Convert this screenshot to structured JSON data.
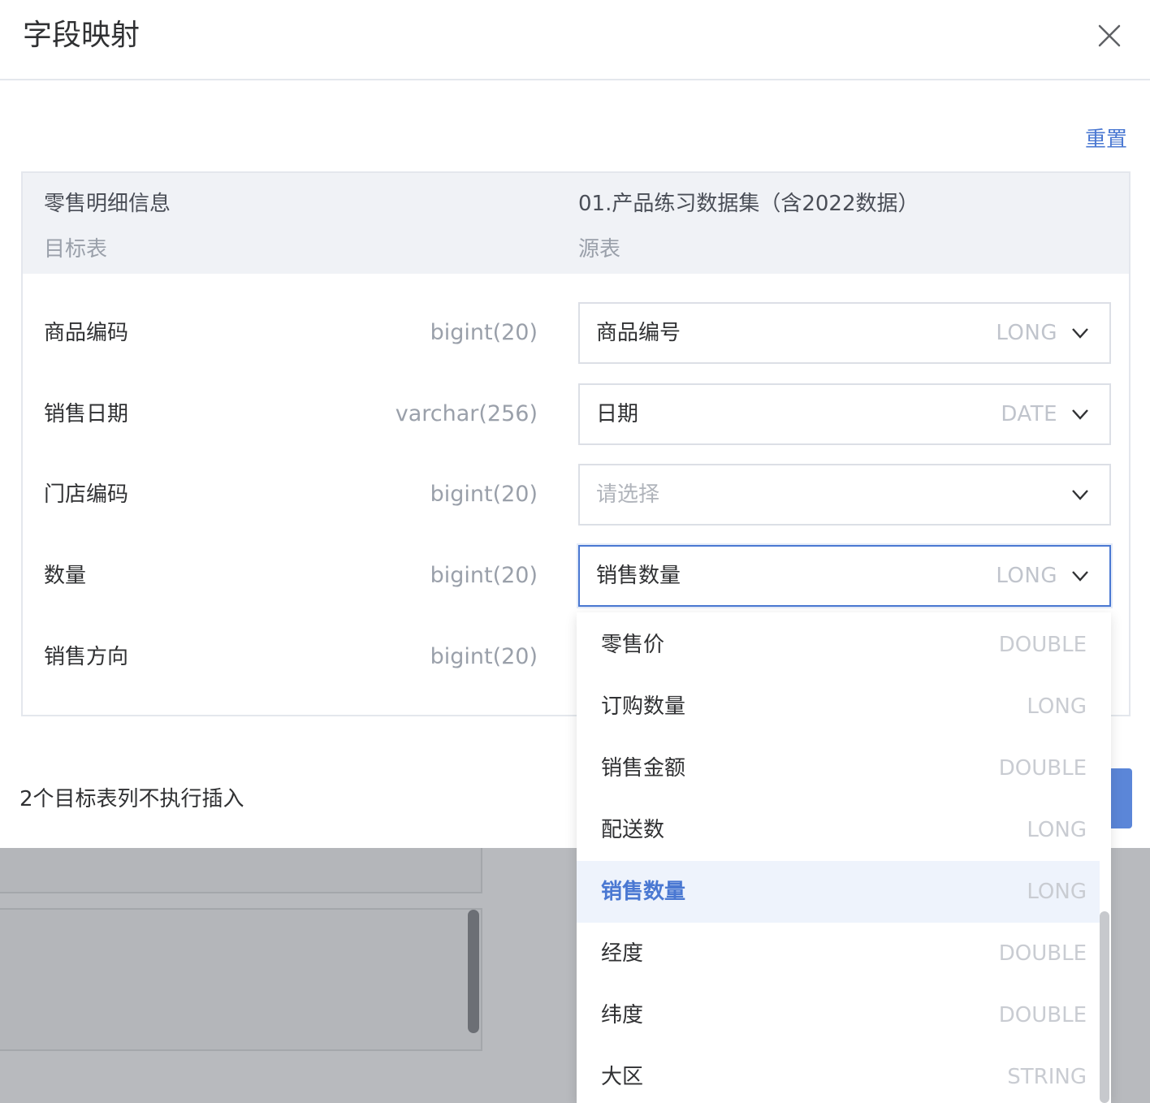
{
  "dialog": {
    "title": "字段映射",
    "reset_label": "重置",
    "footer_note": "2个目标表列不执行插入"
  },
  "target": {
    "name": "零售明细信息",
    "caption": "目标表"
  },
  "source": {
    "name": "01.产品练习数据集（含2022数据）",
    "caption": "源表"
  },
  "rows": [
    {
      "field": "商品编码",
      "type": "bigint(20)",
      "mapped": "商品编号",
      "mapped_type": "LONG"
    },
    {
      "field": "销售日期",
      "type": "varchar(256)",
      "mapped": "日期",
      "mapped_type": "DATE"
    },
    {
      "field": "门店编码",
      "type": "bigint(20)",
      "placeholder": "请选择"
    },
    {
      "field": "数量",
      "type": "bigint(20)",
      "mapped": "销售数量",
      "mapped_type": "LONG"
    },
    {
      "field": "销售方向",
      "type": "bigint(20)"
    }
  ],
  "dropdown": {
    "options": [
      {
        "label": "零售价",
        "type": "DOUBLE"
      },
      {
        "label": "订购数量",
        "type": "LONG"
      },
      {
        "label": "销售金额",
        "type": "DOUBLE"
      },
      {
        "label": "配送数",
        "type": "LONG"
      },
      {
        "label": "销售数量",
        "type": "LONG",
        "selected": true
      },
      {
        "label": "经度",
        "type": "DOUBLE"
      },
      {
        "label": "纬度",
        "type": "DOUBLE"
      },
      {
        "label": "大区",
        "type": "STRING"
      }
    ]
  },
  "colors": {
    "accent": "#4a78d2",
    "header_bg": "#f0f2f6",
    "selected_option_bg": "#eef3fc"
  }
}
